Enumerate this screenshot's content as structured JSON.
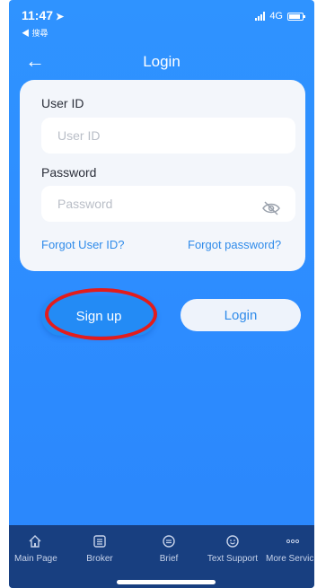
{
  "status_bar": {
    "time": "11:47",
    "location_arrow": "➤",
    "back_app": "◀ 搜尋",
    "network": "4G"
  },
  "nav": {
    "title": "Login",
    "back_glyph": "←"
  },
  "form": {
    "user_id_label": "User ID",
    "user_id_placeholder": "User ID",
    "password_label": "Password",
    "password_placeholder": "Password",
    "forgot_user_id": "Forgot User ID?",
    "forgot_password": "Forgot password?"
  },
  "buttons": {
    "sign_up": "Sign up",
    "login": "Login"
  },
  "tabs": [
    {
      "label": "Main Page",
      "icon": "home-icon"
    },
    {
      "label": "Broker",
      "icon": "list-icon"
    },
    {
      "label": "Brief",
      "icon": "brief-icon"
    },
    {
      "label": "Text Support",
      "icon": "smiley-icon"
    },
    {
      "label": "More Servic",
      "icon": "more-icon"
    }
  ],
  "colors": {
    "primary": "#2d8cff",
    "tabbar": "#183f80",
    "link": "#2f8bea",
    "highlight_ring": "#e31c1c"
  }
}
